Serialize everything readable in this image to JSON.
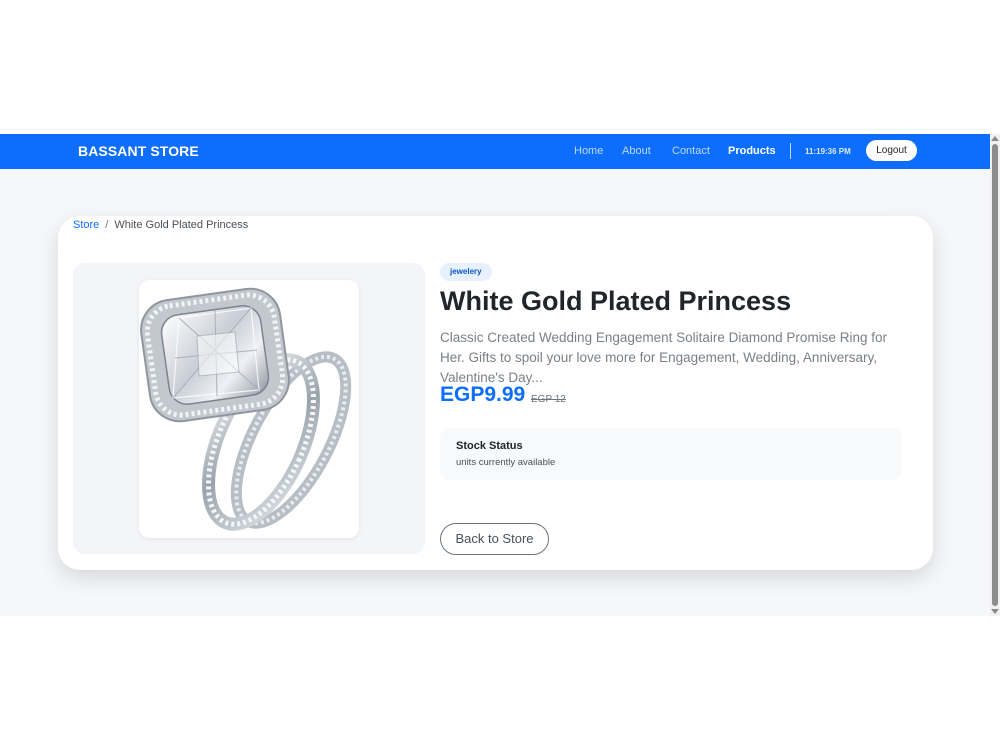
{
  "navbar": {
    "brand": "BASSANT STORE",
    "links": [
      "Home",
      "About",
      "Contact",
      "Products"
    ],
    "active_link": "Products",
    "clock": "11:19:36 PM",
    "logout_label": "Logout",
    "bg_color": "#0d6efd"
  },
  "breadcrumb": {
    "store": "Store",
    "separator": "/",
    "current": "White Gold Plated Princess"
  },
  "product": {
    "category": "jewelery",
    "title": "White Gold Plated Princess",
    "description": "Classic Created Wedding Engagement Solitaire Diamond Promise Ring for Her. Gifts to spoil your love more for Engagement, Wedding, Anniversary, Valentine's Day...",
    "price": "EGP9.99",
    "old_price": "EGP 12",
    "image_icon": "diamond-ring-image"
  },
  "stock": {
    "title": "Stock Status",
    "subtitle": "units currently available"
  },
  "actions": {
    "back_label": "Back to Store"
  }
}
